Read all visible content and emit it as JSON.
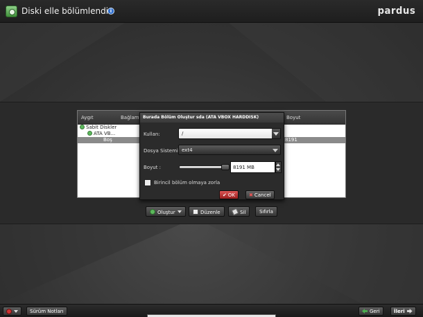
{
  "header": {
    "title": "Diski elle bölümlendir",
    "brand": "pardus"
  },
  "table": {
    "columns": [
      "Aygıt",
      "Bağlam",
      "Boyut"
    ],
    "tree": {
      "root": "Sabit Diskler",
      "disk": "ATA VB...",
      "free": "Boş",
      "free_size": "8191"
    }
  },
  "dialog": {
    "title": "Burada Bölüm Oluştur sda (ATA VBOX HARDDISK)",
    "use_label": "Kullan:",
    "use_value": "/",
    "fs_label": "Dosya Sistemi:",
    "fs_value": "ext4",
    "size_label": "Boyut :",
    "size_value": "8191 MB",
    "size_fraction": 1.0,
    "primary_label": "Birincil bölüm olmaya zorla",
    "primary_checked": false,
    "ok_label": "OK",
    "cancel_label": "Cancel"
  },
  "actions": {
    "create": "Oluştur",
    "edit": "Düzenle",
    "delete": "Sil",
    "reset": "Sıfırla"
  },
  "footer": {
    "release_notes": "Sürüm Notları",
    "back": "Geri",
    "next": "İleri"
  },
  "colors": {
    "accent_red": "#c0392b",
    "accent_green": "#5cb85c",
    "selection_gray": "#8a8a8a"
  }
}
